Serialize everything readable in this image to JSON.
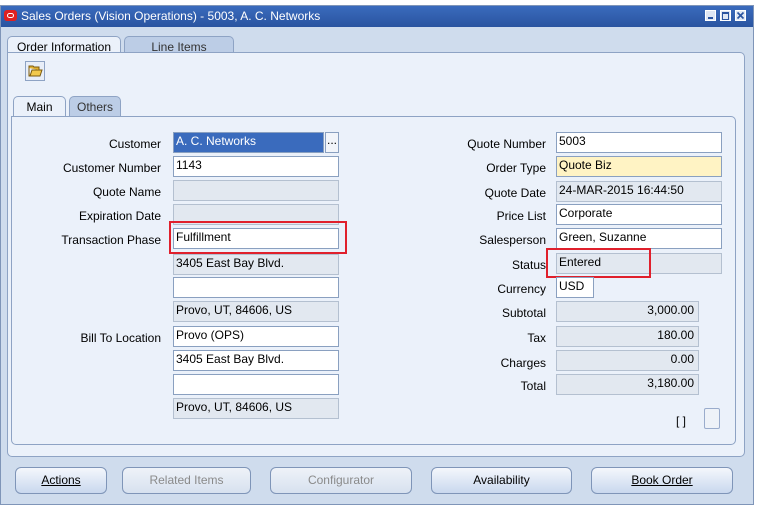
{
  "window": {
    "title": "Sales Orders (Vision Operations) - 5003, A. C. Networks"
  },
  "tabs": {
    "order_information": "Order Information",
    "line_items": "Line Items"
  },
  "subtabs": {
    "main": "Main",
    "others": "Others"
  },
  "left_fields": {
    "customer_label": "Customer",
    "customer_value": "A. C. Networks",
    "customer_lov": "...",
    "customer_number_label": "Customer Number",
    "customer_number_value": "1143",
    "quote_name_label": "Quote Name",
    "quote_name_value": "",
    "expiration_date_label": "Expiration Date",
    "expiration_date_value": "",
    "transaction_phase_label": "Transaction Phase",
    "transaction_phase_value": "Fulfillment",
    "ship_addr_line1": "3405 East Bay Blvd.",
    "ship_addr_line2": "",
    "ship_addr_line3": "Provo, UT, 84606, US",
    "bill_to_location_label": "Bill To Location",
    "bill_to_location_value": "Provo (OPS)",
    "bill_addr_line1": "3405 East Bay Blvd.",
    "bill_addr_line2": "",
    "bill_addr_line3": "Provo, UT, 84606, US"
  },
  "right_fields": {
    "quote_number_label": "Quote Number",
    "quote_number_value": "5003",
    "order_type_label": "Order Type",
    "order_type_value": "Quote Biz",
    "quote_date_label": "Quote Date",
    "quote_date_value": "24-MAR-2015 16:44:50",
    "price_list_label": "Price List",
    "price_list_value": "Corporate",
    "salesperson_label": "Salesperson",
    "salesperson_value": "Green, Suzanne",
    "status_label": "Status",
    "status_value": "Entered",
    "currency_label": "Currency",
    "currency_value": "USD",
    "subtotal_label": "Subtotal",
    "subtotal_value": "3,000.00",
    "tax_label": "Tax",
    "tax_value": "180.00",
    "charges_label": "Charges",
    "charges_value": "0.00",
    "total_label": "Total",
    "total_value": "3,180.00",
    "flex_marker": "[ ]"
  },
  "buttons": {
    "actions": "Actions",
    "related_items": "Related Items",
    "configurator": "Configurator",
    "availability": "Availability",
    "book_order": "Book Order"
  },
  "colors": {
    "title_bar": "#2a54a0",
    "window_bg": "#cfdced",
    "panel_bg": "#ebf1fa",
    "required_field": "#fff3c4",
    "highlight_box": "#e0202c"
  },
  "icons": {
    "app": "oracle-app-icon",
    "open": "open-folder-icon",
    "minimize": "minimize-icon",
    "maximize": "maximize-icon",
    "close": "close-icon"
  }
}
